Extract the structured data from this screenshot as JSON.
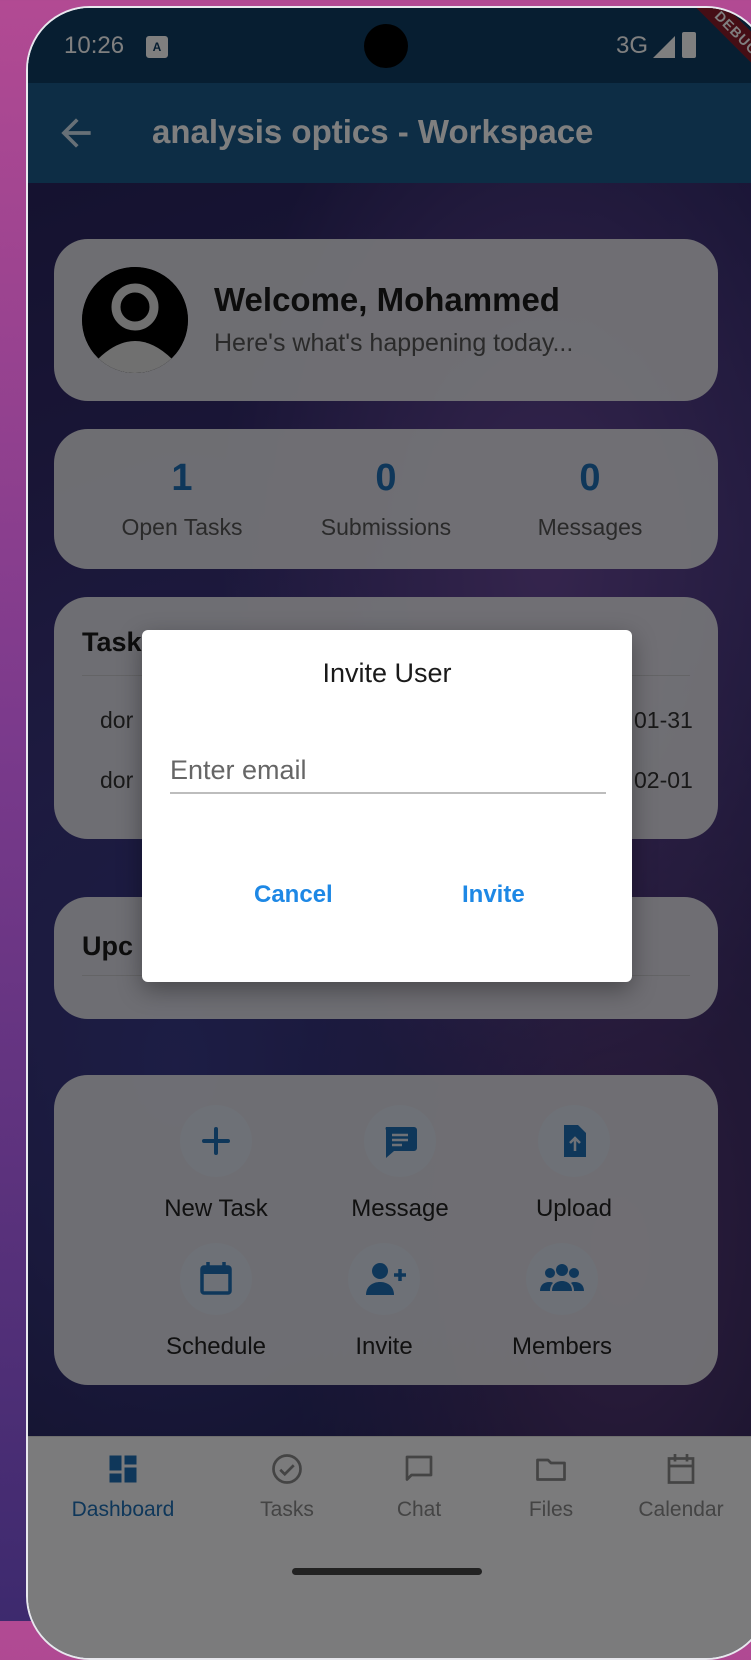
{
  "status_bar": {
    "time": "10:26",
    "network": "3G",
    "debug_badge": "DEBUG"
  },
  "app_bar": {
    "title": "analysis optics - Workspace"
  },
  "welcome": {
    "title": "Welcome, Mohammed",
    "subtitle": "Here's what's happening today..."
  },
  "stats": [
    {
      "value": "1",
      "label": "Open Tasks"
    },
    {
      "value": "0",
      "label": "Submissions"
    },
    {
      "value": "0",
      "label": "Messages"
    }
  ],
  "tasks_section": {
    "title_visible": "Task",
    "rows": [
      {
        "left": "dor",
        "right": "01-31"
      },
      {
        "left": "dor",
        "right": "02-01"
      }
    ]
  },
  "upcoming_section": {
    "title_visible": "Upc"
  },
  "quick_actions": [
    {
      "label": "New Task",
      "icon": "plus-icon"
    },
    {
      "label": "Message",
      "icon": "message-icon"
    },
    {
      "label": "Upload",
      "icon": "upload-file-icon"
    },
    {
      "label": "Schedule",
      "icon": "calendar-icon"
    },
    {
      "label": "Invite",
      "icon": "person-add-icon"
    },
    {
      "label": "Members",
      "icon": "group-icon"
    }
  ],
  "bottom_nav": [
    {
      "label": "Dashboard",
      "icon": "dashboard-icon",
      "active": true
    },
    {
      "label": "Tasks",
      "icon": "check-circle-icon",
      "active": false
    },
    {
      "label": "Chat",
      "icon": "chat-icon",
      "active": false
    },
    {
      "label": "Files",
      "icon": "folder-icon",
      "active": false
    },
    {
      "label": "Calendar",
      "icon": "calendar-icon",
      "active": false
    }
  ],
  "dialog": {
    "title": "Invite User",
    "email_placeholder": "Enter email",
    "email_value": "",
    "cancel_label": "Cancel",
    "invite_label": "Invite"
  },
  "colors": {
    "accent": "#1e6fb5",
    "dialog_button": "#1e88e5",
    "app_bar": "#1a5a8a",
    "status_bar": "#0f3d63"
  }
}
